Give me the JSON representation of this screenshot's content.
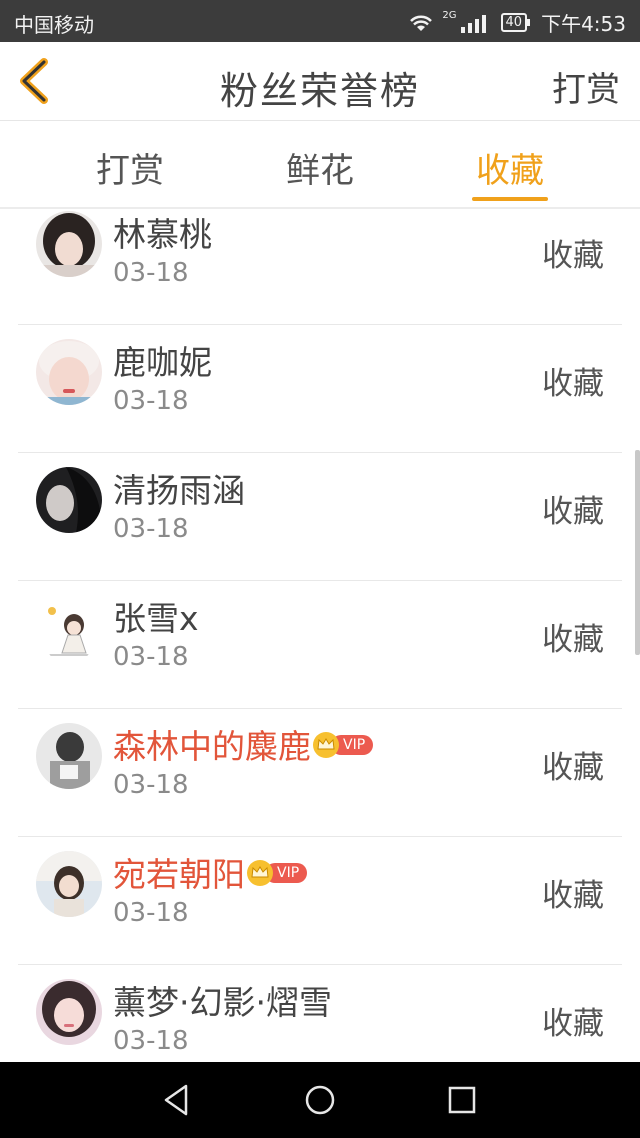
{
  "status_bar": {
    "carrier": "中国移动",
    "network": "2G",
    "battery": "40",
    "time": "下午4:53"
  },
  "header": {
    "title": "粉丝荣誉榜",
    "action": "打赏",
    "back_icon": "chevron-left-icon"
  },
  "tabs": [
    {
      "label": "打赏",
      "active": false
    },
    {
      "label": "鲜花",
      "active": false
    },
    {
      "label": "收藏",
      "active": true
    }
  ],
  "accent_color": "#f0a11b",
  "vip_name_color": "#e2553a",
  "vip_badge_text": "VIP",
  "list": [
    {
      "name": "林慕桃",
      "date": "03-18",
      "action": "收藏",
      "vip": false
    },
    {
      "name": "鹿咖妮",
      "date": "03-18",
      "action": "收藏",
      "vip": false
    },
    {
      "name": "清扬雨涵",
      "date": "03-18",
      "action": "收藏",
      "vip": false
    },
    {
      "name": "张雪x",
      "date": "03-18",
      "action": "收藏",
      "vip": false
    },
    {
      "name": "森林中的麋鹿",
      "date": "03-18",
      "action": "收藏",
      "vip": true
    },
    {
      "name": "宛若朝阳",
      "date": "03-18",
      "action": "收藏",
      "vip": true
    },
    {
      "name": "薰梦·幻影·熠雪",
      "date": "03-18",
      "action": "收藏",
      "vip": false
    }
  ],
  "nav_bar": [
    "back-triangle-icon",
    "home-circle-icon",
    "recents-square-icon"
  ]
}
